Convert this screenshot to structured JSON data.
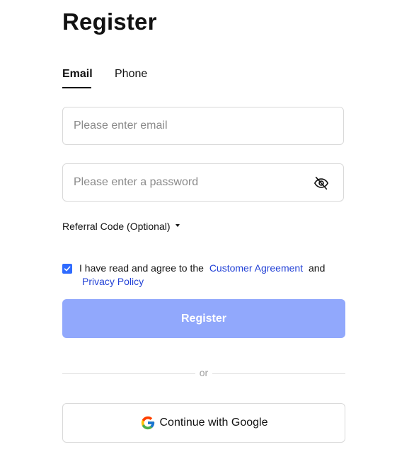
{
  "header": {
    "title": "Register"
  },
  "tabs": [
    {
      "label": "Email",
      "active": true
    },
    {
      "label": "Phone",
      "active": false
    }
  ],
  "form": {
    "email": {
      "placeholder": "Please enter email",
      "value": ""
    },
    "password": {
      "placeholder": "Please enter a password",
      "value": "",
      "toggle_icon": "eye-off-icon"
    },
    "referral_label": "Referral Code (Optional)",
    "agreement": {
      "checked": true,
      "text_before": "I have read and agree to the",
      "customer_agreement": "Customer Agreement",
      "text_between": "and",
      "privacy_policy": "Privacy Policy"
    },
    "submit_label": "Register"
  },
  "divider": {
    "text": "or"
  },
  "social": {
    "google_label": "Continue with Google",
    "icon": "google-icon"
  },
  "colors": {
    "accent": "#2f6bff",
    "link": "#2342d6",
    "submit_disabled": "#91a8fc",
    "border": "#d9d9d9"
  }
}
